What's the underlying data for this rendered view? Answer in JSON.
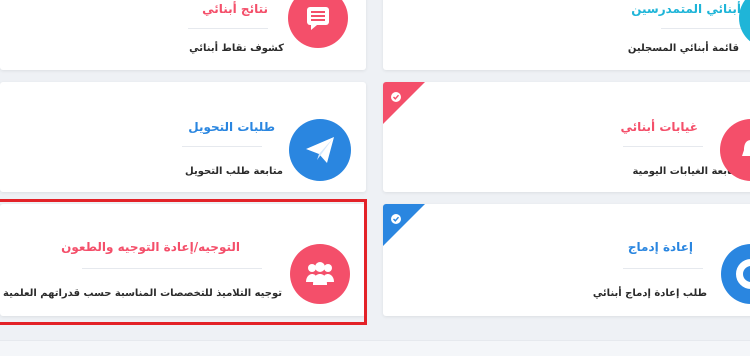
{
  "cards": {
    "results": {
      "title": "نتائج أبنائي",
      "desc": "كشوف نقاط أبنائي",
      "color": "#f44f6a",
      "icon": "list-icon"
    },
    "enrolled": {
      "title": "أبنائي المتمدرسين",
      "desc": "قائمة أبنائي المسجلين",
      "color": "#1fb5d8",
      "icon": "users-icon"
    },
    "transfer": {
      "title": "طلبات التحويل",
      "desc": "متابعة طلب التحويل",
      "color": "#2a86e0",
      "icon": "paper-plane-icon"
    },
    "absences": {
      "title": "غيابات أبنائي",
      "desc": "متابعة الغيابات اليومية",
      "color": "#f44f6a",
      "icon": "bell-icon"
    },
    "orientation": {
      "title": "التوجيه/إعادة التوجيه والطعون",
      "desc": "توجيه التلاميذ للتخصصات المناسبة حسب قدراتهم العلمية",
      "color": "#f44f6a",
      "icon": "group-icon"
    },
    "reintegration": {
      "title": "إعادة إدماج",
      "desc": "طلب إعادة إدماج أبنائي",
      "color": "#2a86e0",
      "icon": "refresh-icon"
    }
  },
  "colors": {
    "red": "#f44f6a",
    "blue": "#2a86e0",
    "cyan": "#1fb5d8",
    "highlight": "#e32228"
  }
}
